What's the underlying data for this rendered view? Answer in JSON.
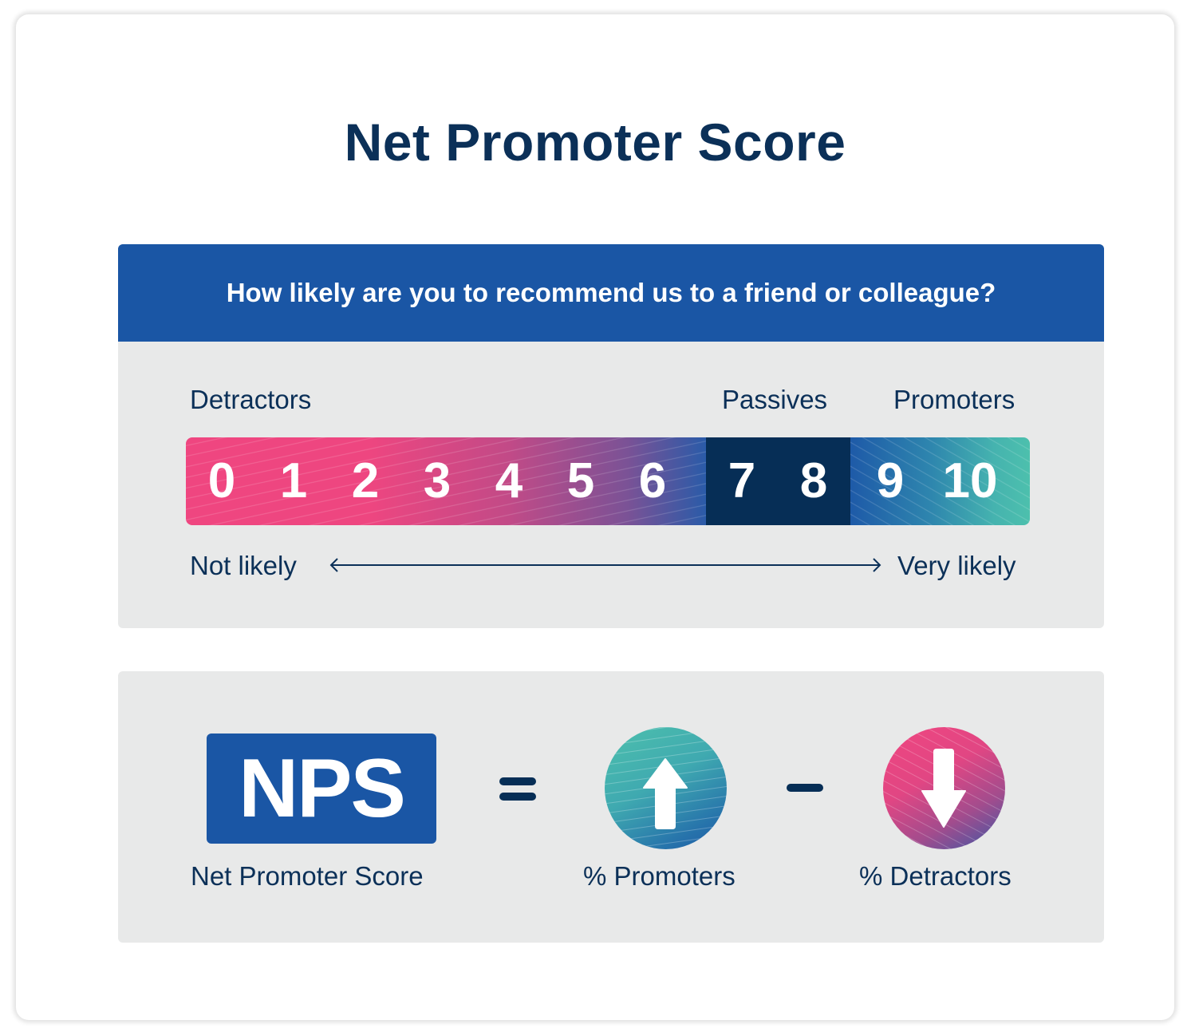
{
  "title": "Net Promoter Score",
  "survey": {
    "question": "How likely are you to recommend us to a friend or colleague?",
    "groups": {
      "detractors": "Detractors",
      "passives": "Passives",
      "promoters": "Promoters"
    },
    "scale": {
      "detractors": [
        "0",
        "1",
        "2",
        "3",
        "4",
        "5",
        "6"
      ],
      "passives": [
        "7",
        "8"
      ],
      "promoters": [
        "9",
        "10"
      ]
    },
    "axis": {
      "low": "Not likely",
      "high": "Very likely"
    },
    "colors": {
      "detractor": "#ef4680",
      "passive": "#062e56",
      "promoter": "#4dc0ad",
      "header": "#1a56a5"
    }
  },
  "formula": {
    "acronym": "NPS",
    "acronym_label": "Net Promoter Score",
    "equals": "=",
    "promoters_label": "% Promoters",
    "minus": "−",
    "detractors_label": "% Detractors",
    "icons": {
      "promoters": "arrow-up-icon",
      "detractors": "arrow-down-icon"
    }
  }
}
